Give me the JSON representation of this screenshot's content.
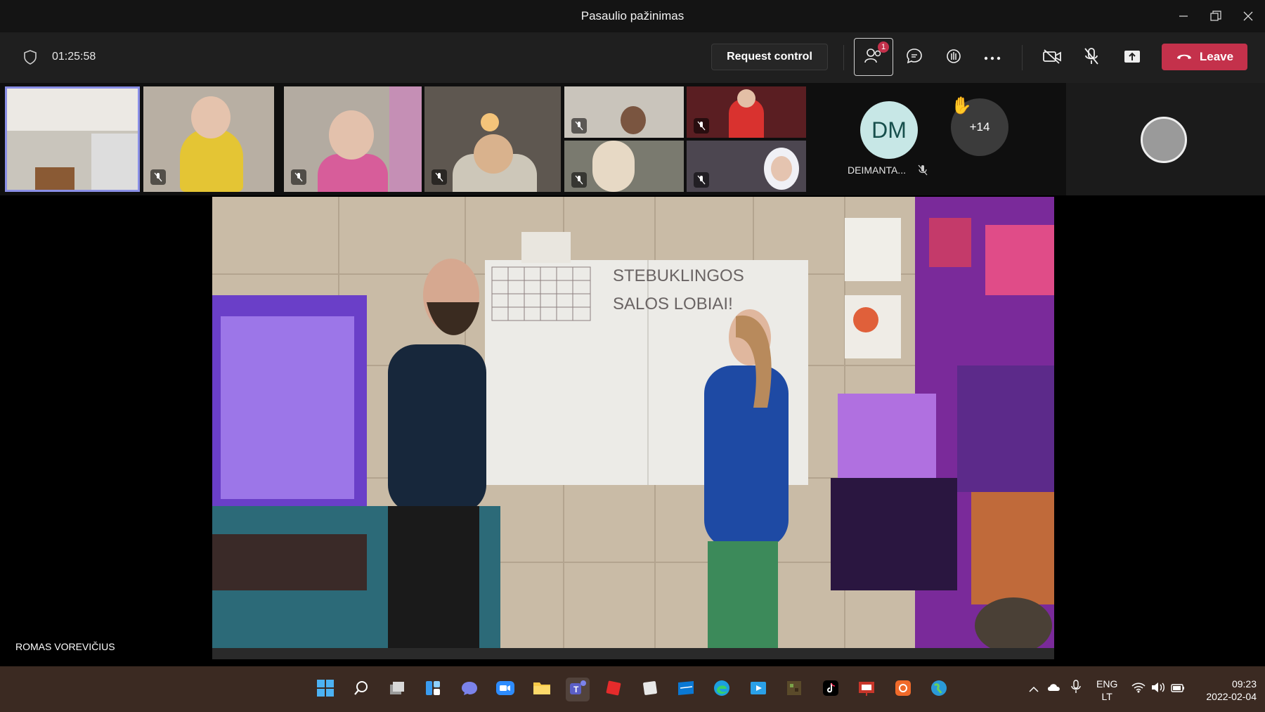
{
  "window": {
    "title": "Pasaulio pažinimas"
  },
  "toolbar": {
    "timer": "01:25:58",
    "request_control_label": "Request control",
    "people_badge": "1",
    "leave_label": "Leave"
  },
  "participants": {
    "dm_initials": "DM",
    "dm_name": "DEIMANTA...",
    "more_count": "+14"
  },
  "stage": {
    "presenter_name": "ROMAS VOREVIČIUS",
    "whiteboard_text_line1": "STEBUKLINGOS",
    "whiteboard_text_line2": "SALOS LOBIAI!"
  },
  "taskbar": {
    "lang_line1": "ENG",
    "lang_line2": "LT",
    "time": "09:23",
    "date": "2022-02-04"
  },
  "colors": {
    "leave": "#c4314b",
    "selected_tile_border": "#8a8fe6",
    "dm_avatar_bg": "#c7e7e6"
  }
}
